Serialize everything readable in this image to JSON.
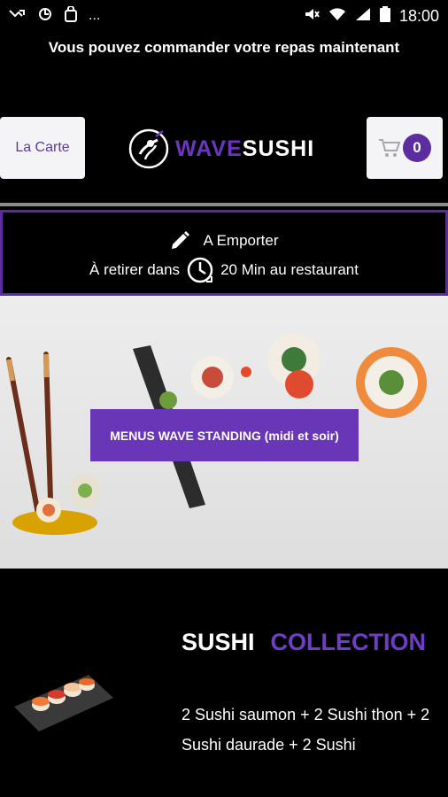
{
  "status_bar": {
    "time": "18:00",
    "left_icons": [
      "missed-call-icon",
      "hand-icon",
      "bag-icon",
      "more-icon"
    ],
    "right_icons": [
      "mute-icon",
      "wifi-icon",
      "signal-icon",
      "battery-icon"
    ],
    "more": "..."
  },
  "header": {
    "title": "Vous pouvez commander votre repas maintenant"
  },
  "nav": {
    "carte_label": "La Carte",
    "logo_wave": "WAVE",
    "logo_sushi": "SUSHI",
    "cart_count": "0"
  },
  "order_info": {
    "mode": "A Emporter",
    "pickup_prefix": "À retirer dans",
    "pickup_suffix": "20 Min au restaurant"
  },
  "banner": {
    "label": "MENUS WAVE STANDING (midi et soir)"
  },
  "collection": {
    "word1": "SUSHI",
    "word2": "COLLECTION",
    "description": "2 Sushi saumon + 2 Sushi thon + 2 Sushi daurade + 2 Sushi"
  },
  "colors": {
    "accent": "#6a36b8",
    "background": "#000000",
    "button_bg": "#f4f4f6"
  }
}
